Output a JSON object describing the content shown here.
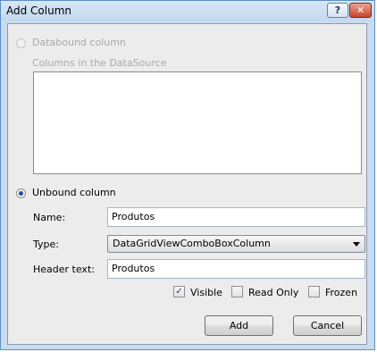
{
  "window": {
    "title": "Add Column",
    "help_glyph": "?",
    "close_glyph": "✕"
  },
  "databound": {
    "radio_label": "Databound column",
    "selected": false,
    "enabled": false,
    "columns_label": "Columns in the DataSource",
    "columns": []
  },
  "unbound": {
    "radio_label": "Unbound column",
    "selected": true,
    "name_label": "Name:",
    "name_value": "Produtos",
    "type_label": "Type:",
    "type_value": "DataGridViewComboBoxColumn",
    "header_label": "Header text:",
    "header_value": "Produtos"
  },
  "options": {
    "visible_label": "Visible",
    "visible_checked": true,
    "readonly_label": "Read Only",
    "readonly_checked": false,
    "frozen_label": "Frozen",
    "frozen_checked": false,
    "check_glyph": "✓"
  },
  "buttons": {
    "add_label": "Add",
    "cancel_label": "Cancel"
  }
}
